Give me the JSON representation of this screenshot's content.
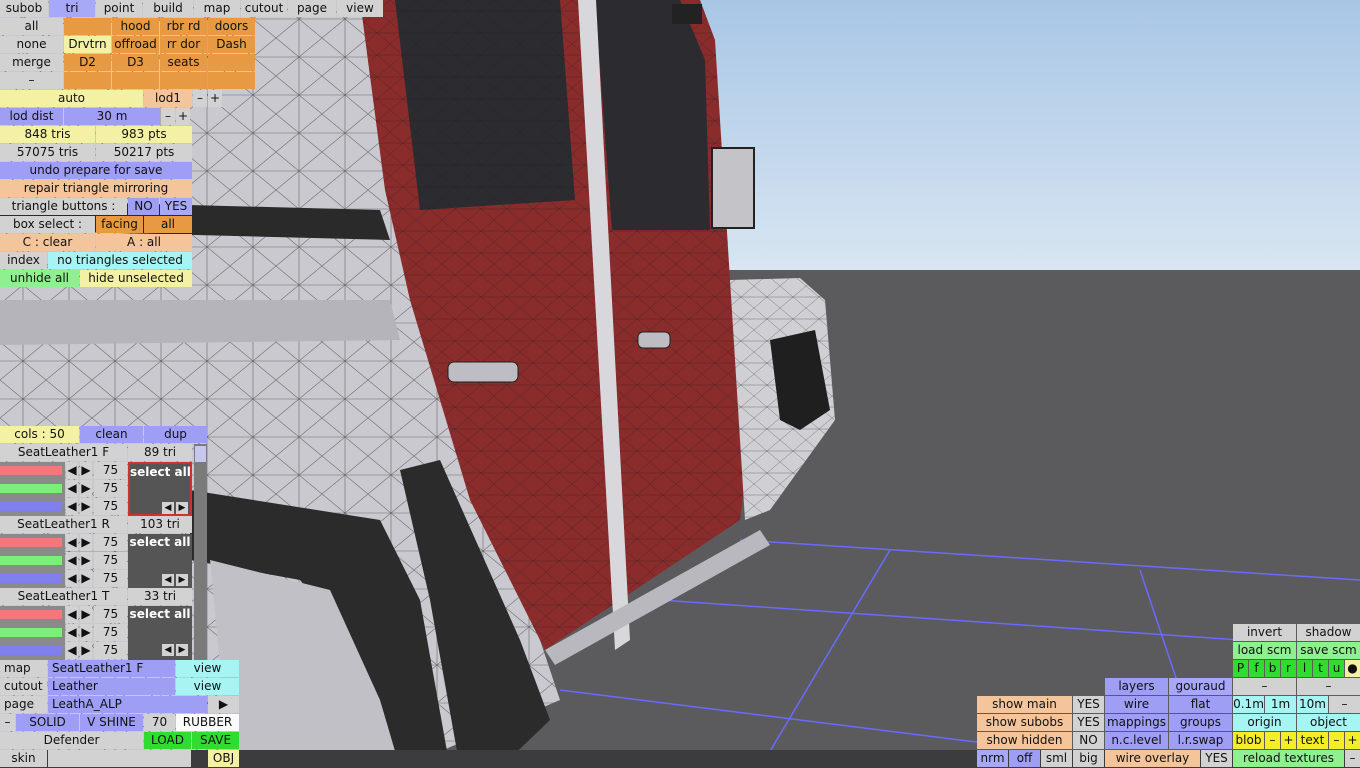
{
  "menu": {
    "items": [
      "subob",
      "tri",
      "point",
      "build",
      "map",
      "cutout",
      "page",
      "view"
    ],
    "active": "tri"
  },
  "subob_grid": {
    "row1": [
      "all",
      "",
      "hood",
      "rbr rd",
      "doors"
    ],
    "row2": [
      "none",
      "Drvtrn",
      "offroad",
      "rr dor",
      "Dash"
    ],
    "row3": [
      "merge",
      "D2",
      "D3",
      "seats",
      ""
    ],
    "row4": [
      "–",
      "",
      "",
      "",
      ""
    ]
  },
  "lod": {
    "auto": "auto",
    "lod_name": "lod1",
    "minus": "–",
    "plus": "+",
    "dist_label": "lod dist",
    "dist_value": "30 m"
  },
  "stats": {
    "tris": "848 tris",
    "pts": "983 pts",
    "total_tris": "57075 tris",
    "total_pts": "50217 pts"
  },
  "actions": {
    "undo": "undo prepare for save",
    "repair": "repair triangle mirroring"
  },
  "triangle_buttons": {
    "label": "triangle buttons :",
    "no": "NO",
    "yes": "YES"
  },
  "box_select": {
    "label": "box select :",
    "facing": "facing",
    "all": "all"
  },
  "keys": {
    "clear": "C : clear",
    "all": "A : all"
  },
  "index": {
    "label": "index",
    "status": "no triangles selected"
  },
  "hide": {
    "unhide_all": "unhide all",
    "hide_unselected": "hide unselected"
  },
  "materials_header": {
    "cols": "cols : 50",
    "clean": "clean",
    "dup": "dup"
  },
  "materials": [
    {
      "name": "SeatLeather1 F",
      "tris": "89 tri",
      "values": [
        "75",
        "75",
        "75"
      ],
      "select": "select all"
    },
    {
      "name": "SeatLeather1 R",
      "tris": "103 tri",
      "values": [
        "75",
        "75",
        "75"
      ],
      "select": "select all"
    },
    {
      "name": "SeatLeather1 T",
      "tris": "33 tri",
      "values": [
        "75",
        "75",
        "75"
      ],
      "select": "select all"
    }
  ],
  "map_panel": {
    "map_label": "map",
    "map_value": "SeatLeather1 F",
    "map_view": "view",
    "cutout_label": "cutout",
    "cutout_value": "Leather",
    "cutout_view": "view",
    "page_label": "page",
    "page_value": "LeathA_ALP",
    "page_arrow": "▶",
    "minus": "–",
    "solid": "SOLID",
    "shine": "V SHINE",
    "shine_value": "70",
    "rubber": "RUBBER",
    "model": "Defender",
    "load": "LOAD",
    "save": "SAVE",
    "skin": "skin",
    "obj": "OBJ"
  },
  "right_panel": {
    "invert": "invert",
    "shadow": "shadow",
    "load_scm": "load scm",
    "save_scm": "save scm",
    "flags": [
      "P",
      "f",
      "b",
      "r",
      "l",
      "t",
      "u",
      "●"
    ],
    "dash1": "–",
    "dash2": "–",
    "size1": "0.1m",
    "size2": "1m",
    "size3": "10m",
    "size_minus": "–",
    "origin": "origin",
    "object": "object",
    "blob": "blob",
    "text": "text",
    "minus": "–",
    "plus": "+",
    "reload": "reload textures",
    "layers": "layers",
    "gouraud": "gouraud",
    "wire": "wire",
    "flat": "flat",
    "mappings": "mappings",
    "groups": "groups",
    "nclevel": "n.c.level",
    "lrswap": "l.r.swap",
    "wire_overlay": "wire overlay",
    "wire_overlay_val": "YES",
    "show_main": "show main",
    "show_main_val": "YES",
    "show_subobs": "show subobs",
    "show_subobs_val": "YES",
    "show_hidden": "show hidden",
    "show_hidden_val": "NO",
    "nrm": "nrm",
    "off": "off",
    "sml": "sml",
    "big": "big"
  },
  "colors": {
    "sky": "#bcd4ec",
    "floor": "#5a5a5c",
    "body_red": "#8a2a2a",
    "grid": "#6a6aff"
  }
}
